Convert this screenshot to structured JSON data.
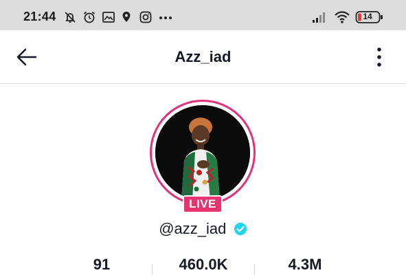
{
  "status_bar": {
    "time": "21:44",
    "left_icons": [
      "alarm-off-icon",
      "alarm-clock-icon",
      "gallery-icon",
      "location-icon",
      "instagram-icon",
      "more-dots-icon"
    ],
    "right_icons": [
      "signal-icon",
      "wifi-icon",
      "battery-icon"
    ],
    "battery_level": "14"
  },
  "nav": {
    "title": "Azz_iad",
    "back_icon": "arrow-left-icon",
    "more_icon": "vertical-dots-icon"
  },
  "profile": {
    "live_label": "LIVE",
    "username": "@azz_iad",
    "verified": true,
    "ring_color": "#e2327a",
    "live_color": "#e8336f",
    "verified_color": "#20d5ec"
  },
  "stats": [
    {
      "value": "91"
    },
    {
      "value": "460.0K"
    },
    {
      "value": "4.3M"
    }
  ]
}
